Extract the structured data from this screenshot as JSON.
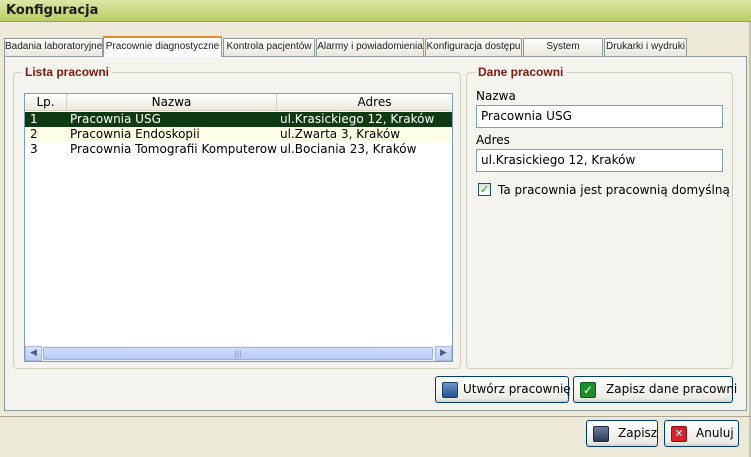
{
  "window": {
    "title": "Konfiguracja"
  },
  "tabs": [
    {
      "label": "Badania laboratoryjne"
    },
    {
      "label": "Pracownie diagnostyczne",
      "active": true
    },
    {
      "label": "Kontrola pacjentów"
    },
    {
      "label": "Alarmy i powiadomienia"
    },
    {
      "label": "Konfiguracja dostępu"
    },
    {
      "label": "System"
    },
    {
      "label": "Drukarki i wydruki"
    }
  ],
  "list_group": {
    "title": "Lista pracowni",
    "columns": [
      "Lp.",
      "Nazwa",
      "Adres"
    ],
    "rows": [
      {
        "lp": "1",
        "nazwa": "Pracownia USG",
        "adres": "ul.Krasickiego 12, Kraków",
        "selected": true
      },
      {
        "lp": "2",
        "nazwa": "Pracownia Endoskopii",
        "adres": "ul.Zwarta 3, Kraków"
      },
      {
        "lp": "3",
        "nazwa": "Pracownia Tomografii Komputerowej",
        "adres": "ul.Bociania 23, Kraków"
      }
    ],
    "scroll_thumb_glyph": "|||"
  },
  "details_group": {
    "title": "Dane pracowni",
    "name_label": "Nazwa",
    "name_value": "Pracownia USG",
    "address_label": "Adres",
    "address_value": "ul.Krasickiego 12, Kraków",
    "default_checkbox_label": "Ta pracownia jest pracownią domyślną",
    "default_checked": true
  },
  "actions": {
    "create_label": "Utwórz pracownię",
    "save_details_label": "Zapisz dane pracowni"
  },
  "footer": {
    "save_label": "Zapisz",
    "cancel_label": "Anuluj"
  },
  "colors": {
    "title_bar": "#C7D77E",
    "group_title": "#7E1A12",
    "selected_row": "#0F3A12",
    "tab_highlight": "#E68B2C"
  },
  "icons": {
    "create": "new-lab-icon",
    "save_details": "checkmark-icon",
    "save": "floppy-disk-icon",
    "cancel": "close-icon"
  }
}
